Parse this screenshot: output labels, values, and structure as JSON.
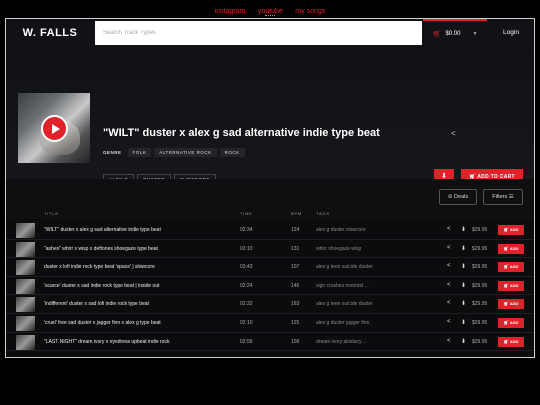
{
  "top_nav": {
    "links": [
      "instagram",
      "youtube",
      "my songs"
    ]
  },
  "header": {
    "logo": "W. FALLS",
    "search_placeholder": "Search Track Types",
    "cart_total": "$0.00",
    "login_label": "Login"
  },
  "hero": {
    "title": "\"WILT\" duster x alex g sad alternative indie type beat",
    "genres_label": "GENRE",
    "genres": [
      "FOLK",
      "ALTERNATIVE ROCK",
      "ROCK"
    ],
    "tags": [
      "ALEX G",
      "DUSTER",
      "SLOWCORE"
    ],
    "download_icon": "download-icon",
    "add_to_cart_label": "ADD TO CART"
  },
  "controls": {
    "deals_label": "Deals",
    "filters_label": "Filters"
  },
  "table": {
    "headers": {
      "title": "TITLE",
      "time": "TIME",
      "bpm": "BPM",
      "tags": "TAGS"
    },
    "rows": [
      {
        "title": "\"WILT\" duster x alex g sad alternative indie type beat",
        "time": "02:34",
        "bpm": "124",
        "tags": "alex g  duster  slowcore",
        "price": "$29.95",
        "add": "ADD"
      },
      {
        "title": "\"ashes\" whirr x wisp x deftones shoegaze type beat",
        "time": "03:10",
        "bpm": "131",
        "tags": "whirr  shoegaze  wisp",
        "price": "$29.95",
        "add": "ADD"
      },
      {
        "title": "duster x lofi indie rock type beat 'space' | slowcore",
        "time": "03:43",
        "bpm": "107",
        "tags": "alex g  teen suicide  duster",
        "price": "$29.95",
        "add": "ADD"
      },
      {
        "title": "'scarce' duster x sad indie rock type beat | inside out",
        "time": "02:24",
        "bpm": "146",
        "tags": "sign crushes motorist ...",
        "price": "$29.95",
        "add": "ADD"
      },
      {
        "title": "'indifferent' duster x sad lofi indie rock type beat",
        "time": "02:32",
        "bpm": "163",
        "tags": "alex g  teen suicide  duster",
        "price": "$29.95",
        "add": "ADD"
      },
      {
        "title": "'cruel' free sad duster x jagger finn x alex g type beat",
        "time": "02:10",
        "bpm": "125",
        "tags": "alex g  duster  jagger finn",
        "price": "$29.95",
        "add": "ADD"
      },
      {
        "title": "\"LAST NIGHT\" dream ivory x eyedress upbeat indie rock",
        "time": "02:56",
        "bpm": "109",
        "tags": "dream ivory  akistacy ...",
        "price": "$29.95",
        "add": "ADD"
      }
    ]
  },
  "colors": {
    "accent": "#e0222b",
    "background": "#0c0c0e"
  }
}
